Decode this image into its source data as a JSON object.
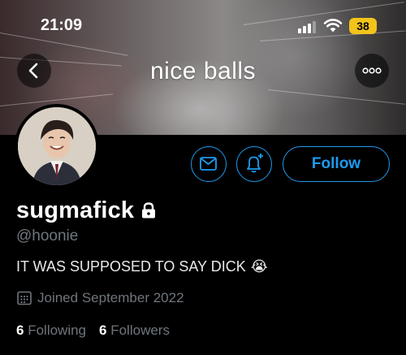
{
  "status_bar": {
    "time": "21:09",
    "battery_level": "38"
  },
  "banner": {
    "caption": "nice balls"
  },
  "profile": {
    "display_name": "sugmafick",
    "handle": "@hoonie",
    "bio": "IT WAS SUPPOSED TO SAY DICK",
    "bio_emoji": "😭",
    "joined": "Joined September 2022",
    "following_count": "6",
    "following_label": "Following",
    "followers_count": "6",
    "followers_label": "Followers"
  },
  "actions": {
    "follow_label": "Follow"
  },
  "icons": [
    "back-arrow-icon",
    "more-icon",
    "mail-icon",
    "bell-plus-icon",
    "lock-icon",
    "calendar-icon",
    "signal-icon",
    "wifi-icon"
  ],
  "colors": {
    "accent": "#1d9bf0",
    "muted_text": "#6e767d",
    "battery": "#f2c31b"
  }
}
